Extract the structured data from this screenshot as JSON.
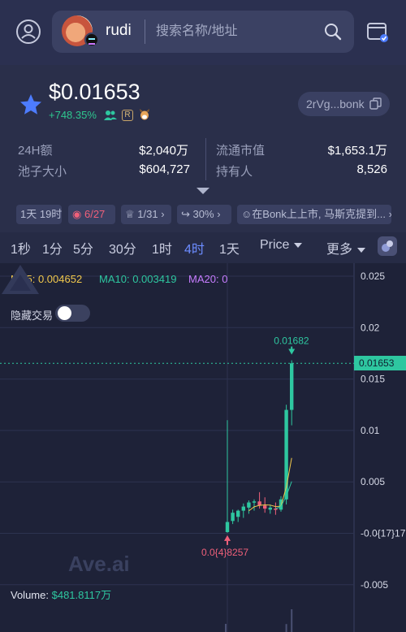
{
  "header": {
    "token_name": "rudi",
    "search_placeholder": "搜索名称/地址"
  },
  "token": {
    "price": "$0.01653",
    "change": "+748.35%",
    "r_badge": "R",
    "address": "2rVg...bonk"
  },
  "stats": {
    "vol24_label": "24H额",
    "vol24_value": "$2,040万",
    "pool_label": "池子大小",
    "pool_value": "$604,727",
    "mcap_label": "流通市值",
    "mcap_value": "$1,653.1万",
    "holders_label": "持有人",
    "holders_value": "8,526"
  },
  "tags": [
    {
      "text": "1天 19时"
    },
    {
      "text_a": "6",
      "text_b": "/27"
    },
    {
      "text": "1/31"
    },
    {
      "text": "30%"
    },
    {
      "text": "在Bonk上上市, 马斯克提到..."
    }
  ],
  "intervals": {
    "items": [
      "1秒",
      "1分",
      "5分",
      "30分",
      "1时",
      "4时",
      "1天"
    ],
    "active": "4时",
    "price_label": "Price",
    "more_label": "更多"
  },
  "chart_data": {
    "type": "candlestick",
    "ma": {
      "ma5_label": "MA5:",
      "ma5": "0.004652",
      "ma10_label": "MA10:",
      "ma10": "0.003419",
      "ma20_label": "MA20:",
      "ma20": "0"
    },
    "y_ticks": [
      "0.025",
      "0.02",
      "0.015",
      "0.01",
      "0.005",
      "-0.0{17}17",
      "-0.005"
    ],
    "current_price_label": "0.01653",
    "high_marker": "0.01682",
    "low_marker": "0.0{4}8257",
    "toggle_label": "隐藏交易",
    "toggle_on": false,
    "watermark": "Ave.ai",
    "volume_label": "Volume:",
    "volume_value": "$481.8117万",
    "colors": {
      "up": "#2ec7a0",
      "down": "#f0607a",
      "ma5": "#f2c94c",
      "ma10": "#2ec7a0",
      "ma20": "#c77dff"
    },
    "candles": [
      {
        "o": 0.00012,
        "h": 0.011,
        "l": 5e-05,
        "c": 0.0011
      },
      {
        "o": 0.0012,
        "h": 0.0023,
        "l": 0.0009,
        "c": 0.002
      },
      {
        "o": 0.0016,
        "h": 0.0023,
        "l": 0.0011,
        "c": 0.0022
      },
      {
        "o": 0.0022,
        "h": 0.0029,
        "l": 0.0015,
        "c": 0.0026
      },
      {
        "o": 0.0025,
        "h": 0.0032,
        "l": 0.0019,
        "c": 0.003
      },
      {
        "o": 0.003,
        "h": 0.0033,
        "l": 0.0022,
        "c": 0.0031
      },
      {
        "o": 0.0031,
        "h": 0.004,
        "l": 0.0024,
        "c": 0.0027
      },
      {
        "o": 0.0027,
        "h": 0.0035,
        "l": 0.002,
        "c": 0.0024
      },
      {
        "o": 0.0023,
        "h": 0.0028,
        "l": 0.0019,
        "c": 0.0025
      },
      {
        "o": 0.0024,
        "h": 0.003,
        "l": 0.0018,
        "c": 0.0023
      },
      {
        "o": 0.0023,
        "h": 0.0036,
        "l": 0.0021,
        "c": 0.0033
      },
      {
        "o": 0.0033,
        "h": 0.0125,
        "l": 0.0028,
        "c": 0.012
      },
      {
        "o": 0.012,
        "h": 0.01682,
        "l": 0.0105,
        "c": 0.01653
      }
    ]
  }
}
